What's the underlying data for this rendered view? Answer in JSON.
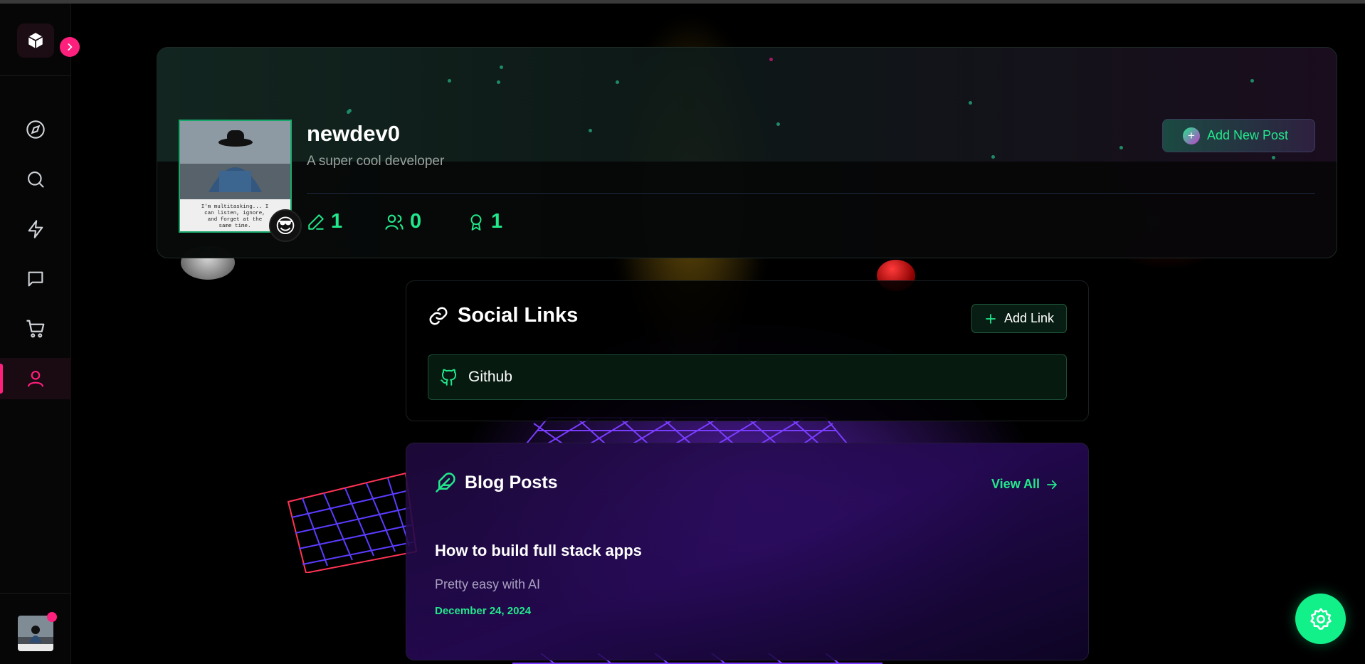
{
  "sidebar": {
    "logo_icon": "cube-icon",
    "expand_icon": "chevron-right-icon",
    "nav": [
      {
        "name": "explore",
        "icon": "compass-icon"
      },
      {
        "name": "search",
        "icon": "search-icon"
      },
      {
        "name": "activity",
        "icon": "lightning-icon"
      },
      {
        "name": "messages",
        "icon": "message-icon"
      },
      {
        "name": "shop",
        "icon": "cart-icon"
      },
      {
        "name": "profile",
        "icon": "user-icon",
        "active": true
      }
    ],
    "accent": "#ff1f7d"
  },
  "profile": {
    "username": "newdev0",
    "bio": "A super cool developer",
    "photo_caption": "I'm multitasking... I can listen, ignore, and forget at the same time.",
    "emoji": "😎",
    "stats": {
      "posts": "1",
      "followers": "0",
      "achievements": "1"
    },
    "add_post_label": "Add New Post"
  },
  "social_links": {
    "title": "Social Links",
    "add_label": "Add Link",
    "links": [
      {
        "label": "Github",
        "icon": "github-icon"
      }
    ]
  },
  "blog_posts": {
    "title": "Blog Posts",
    "view_all_label": "View All",
    "posts": [
      {
        "title": "How to build full stack apps",
        "excerpt": "Pretty easy with AI",
        "date": "December 24, 2024"
      }
    ]
  },
  "colors": {
    "accent_green": "#22e88c",
    "accent_pink": "#ff1f7d",
    "fab": "#12f08a"
  }
}
